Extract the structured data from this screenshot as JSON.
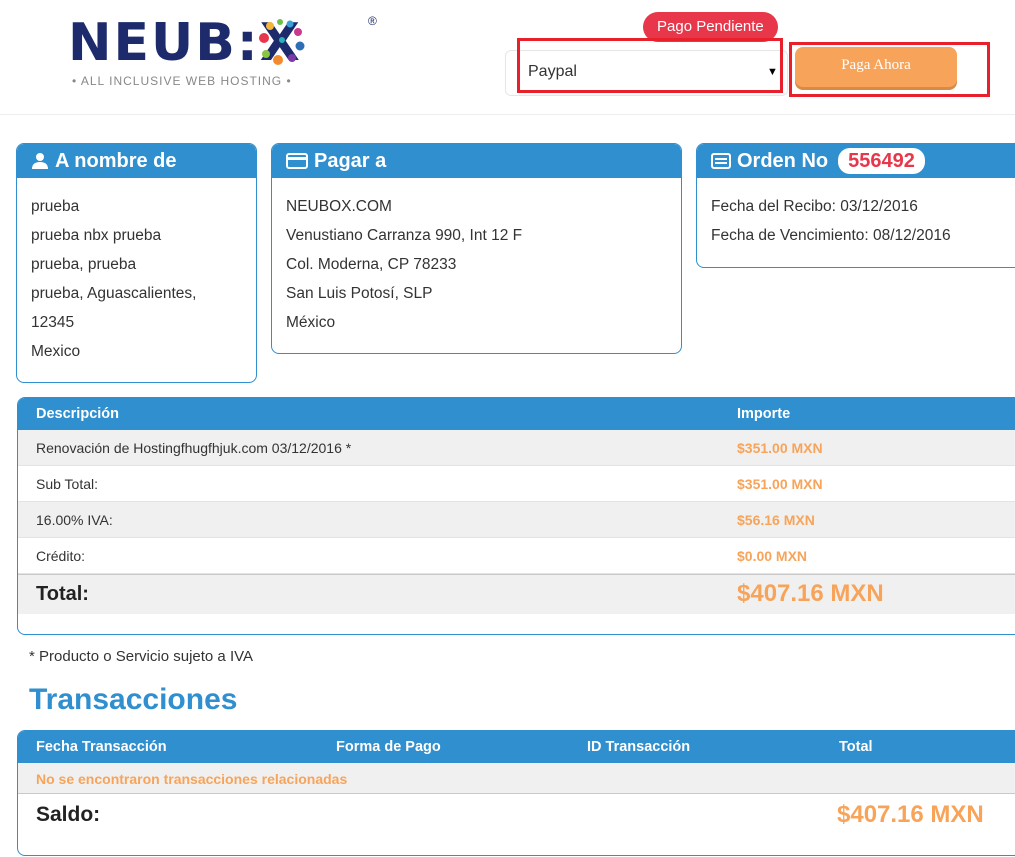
{
  "brand": {
    "logo_text": "NEUB:X",
    "tagline": "• ALL INCLUSIVE WEB HOSTING •",
    "registered": "®"
  },
  "payment": {
    "status_badge": "Pago Pendiente",
    "method_selected": "Paypal",
    "pay_button": "Paga Ahora"
  },
  "cards": {
    "bill_to": {
      "title": "A nombre de",
      "icon": "user-icon",
      "lines": [
        "prueba",
        "prueba nbx prueba",
        "prueba, prueba",
        "prueba, Aguascalientes,",
        "12345",
        "Mexico"
      ]
    },
    "pay_to": {
      "title": "Pagar a",
      "icon": "credit-card-icon",
      "lines": [
        "NEUBOX.COM",
        "Venustiano Carranza 990, Int 12 F",
        "Col. Moderna, CP 78233",
        "San Luis Potosí, SLP",
        "México"
      ]
    },
    "order": {
      "title": "Orden No",
      "icon": "list-icon",
      "number": "556492",
      "lines": [
        "Fecha del Recibo: 03/12/2016",
        "Fecha de Vencimiento: 08/12/2016"
      ]
    }
  },
  "invoice": {
    "headers": [
      "Descripción",
      "Importe"
    ],
    "rows": [
      {
        "desc": "Renovación de Hostingfhugfhjuk.com 03/12/2016 *",
        "amount": "$351.00 MXN"
      },
      {
        "desc": "Sub Total:",
        "amount": "$351.00 MXN"
      },
      {
        "desc": "16.00% IVA:",
        "amount": "$56.16 MXN"
      },
      {
        "desc": "Crédito:",
        "amount": "$0.00 MXN"
      }
    ],
    "total_label": "Total:",
    "total_value": "$407.16 MXN"
  },
  "footnote": "* Producto o Servicio sujeto a IVA",
  "transactions": {
    "title": "Transacciones",
    "headers": [
      "Fecha Transacción",
      "Forma de Pago",
      "ID Transacción",
      "Total"
    ],
    "empty_message": "No se encontraron transacciones relacionadas",
    "balance_label": "Saldo:",
    "balance_value": "$407.16 MXN"
  },
  "colors": {
    "primary": "#2f8fcf",
    "accent": "#f7a45a",
    "danger": "#e8364a",
    "highlight_box": "#e8202c"
  }
}
